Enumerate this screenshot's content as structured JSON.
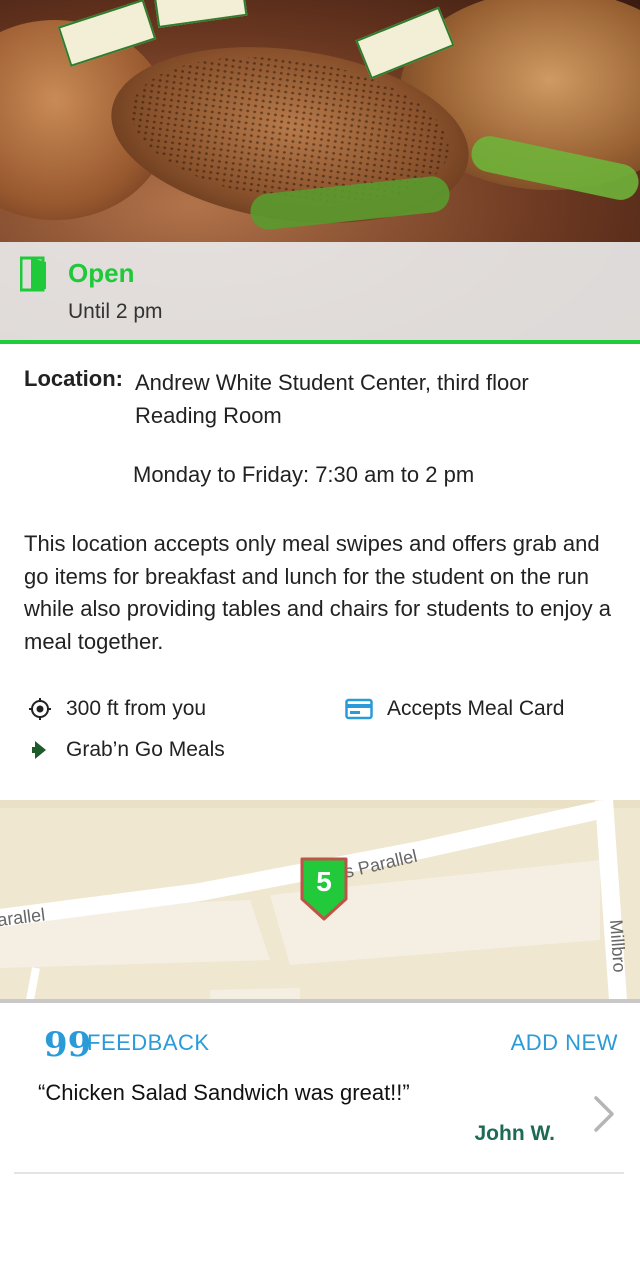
{
  "status": {
    "state": "Open",
    "until": "Until 2 pm",
    "color": "#20c93a"
  },
  "details": {
    "location_key": "Location:",
    "location_value": "Andrew White Student Center, third floor Reading Room",
    "hours": "Monday to Friday: 7:30 am to 2 pm",
    "description": "This location accepts only meal swipes and offers grab and go items for breakfast and lunch for the student on the run while also providing tables and chairs for students to enjoy a meal together."
  },
  "features": {
    "distance": "300 ft from you",
    "meal_card": "Accepts Meal Card",
    "grab_go": "Grab’n Go Meals"
  },
  "map": {
    "marker_number": "5",
    "street_left": "arallel",
    "street_right": "s Parallel",
    "street_side": "Millbro"
  },
  "feedback": {
    "quote_icon": "99",
    "title": "FEEDBACK",
    "add_new": "ADD NEW",
    "comment": "“Chicken Salad Sandwich was great!!”",
    "author": "John W."
  },
  "colors": {
    "accent_blue": "#2a9bd8",
    "author_green": "#1d6b55"
  }
}
